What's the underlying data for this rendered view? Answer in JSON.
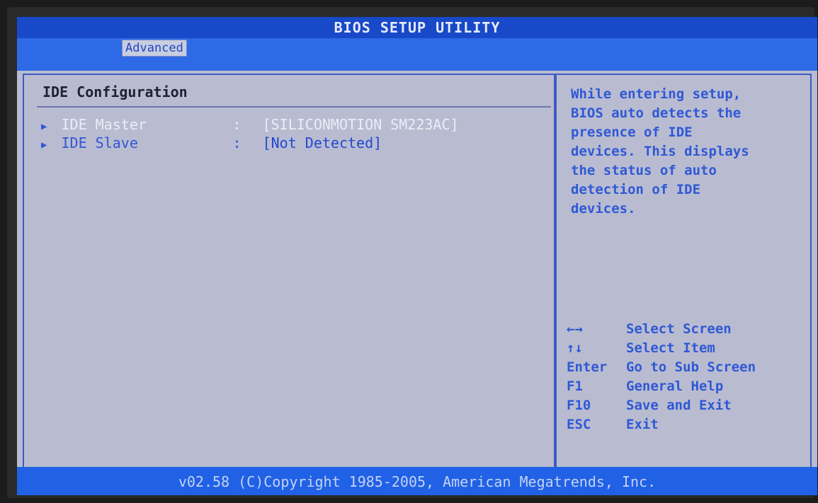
{
  "title": "BIOS SETUP UTILITY",
  "tabs": [
    {
      "label": "Advanced",
      "active": true
    }
  ],
  "section": {
    "title": "IDE Configuration"
  },
  "menu": [
    {
      "label": "IDE Master",
      "value": "[SILICONMOTION SM223AC]",
      "selected": true
    },
    {
      "label": "IDE Slave",
      "value": "[Not Detected]",
      "selected": false
    }
  ],
  "separator": ":",
  "help": {
    "lines": [
      "While entering setup,",
      "BIOS auto detects the",
      "presence of IDE",
      "devices. This displays",
      "the status of auto",
      "detection of IDE",
      "devices."
    ]
  },
  "keys": [
    {
      "key": "←→",
      "action": "Select Screen"
    },
    {
      "key": "↑↓",
      "action": "Select Item"
    },
    {
      "key": "Enter",
      "action": "Go to Sub Screen"
    },
    {
      "key": "F1",
      "action": "General Help"
    },
    {
      "key": "F10",
      "action": "Save and Exit"
    },
    {
      "key": "ESC",
      "action": "Exit"
    }
  ],
  "footer": "v02.58 (C)Copyright 1985-2005, American Megatrends, Inc.",
  "colors": {
    "header": "#1849c9",
    "tabbar": "#2f6ae6",
    "panel": "#b9bcd0",
    "help_text": "#2f58d6"
  }
}
